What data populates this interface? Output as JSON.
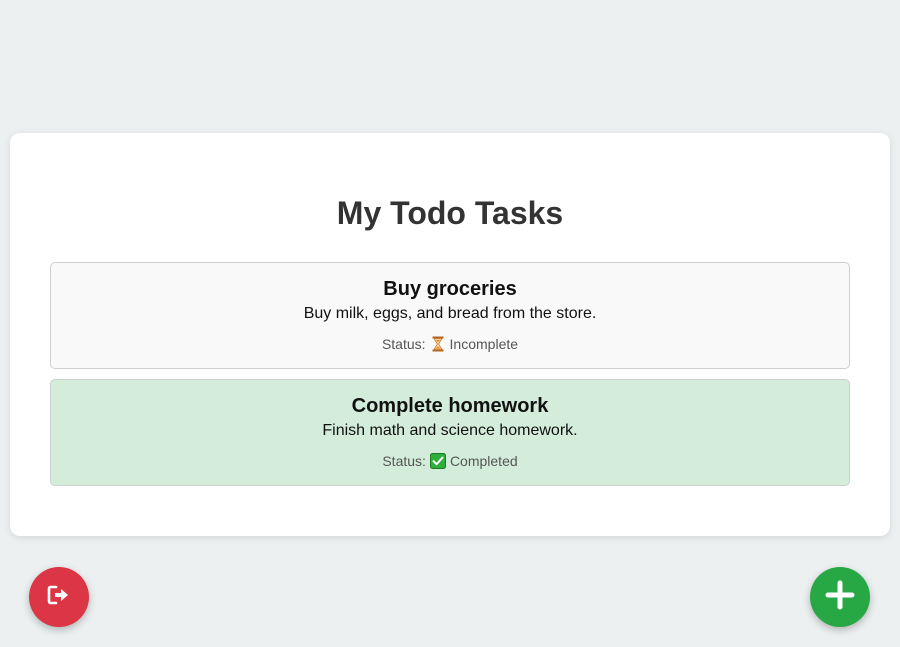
{
  "page": {
    "title": "My Todo Tasks"
  },
  "tasks": [
    {
      "title": "Buy groceries",
      "description": "Buy milk, eggs, and bread from the store.",
      "status_label": "Status:",
      "status_icon": "hourglass-icon",
      "status_text": "Incomplete",
      "completed": false
    },
    {
      "title": "Complete homework",
      "description": "Finish math and science homework.",
      "status_label": "Status:",
      "status_icon": "check-box-icon",
      "status_text": "Completed",
      "completed": true
    }
  ],
  "buttons": {
    "logout_icon": "sign-out-icon",
    "add_icon": "plus-icon"
  },
  "colors": {
    "background": "#ecf0f1",
    "card": "#ffffff",
    "task_incomplete_bg": "#f9f9f9",
    "task_completed_bg": "#d4edda",
    "logout_button": "#dc3545",
    "add_button": "#28a745"
  }
}
